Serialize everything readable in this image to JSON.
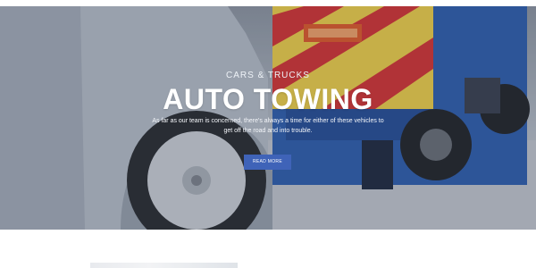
{
  "hero": {
    "eyebrow": "CARS & TRUCKS",
    "title": "AUTO TOWING",
    "description": "As far as our team is concerned, there's always a time for either of these vehicles to get off the road and into trouble.",
    "button_label": "READ MORE"
  },
  "colors": {
    "button": "#3f63b8",
    "truck_blue": "#2f5fb0",
    "chevron_red": "#d83434",
    "chevron_yellow": "#f3d34a",
    "overlay": "#283246"
  },
  "below": {
    "thumbnail_name": "image-thumbnail"
  }
}
